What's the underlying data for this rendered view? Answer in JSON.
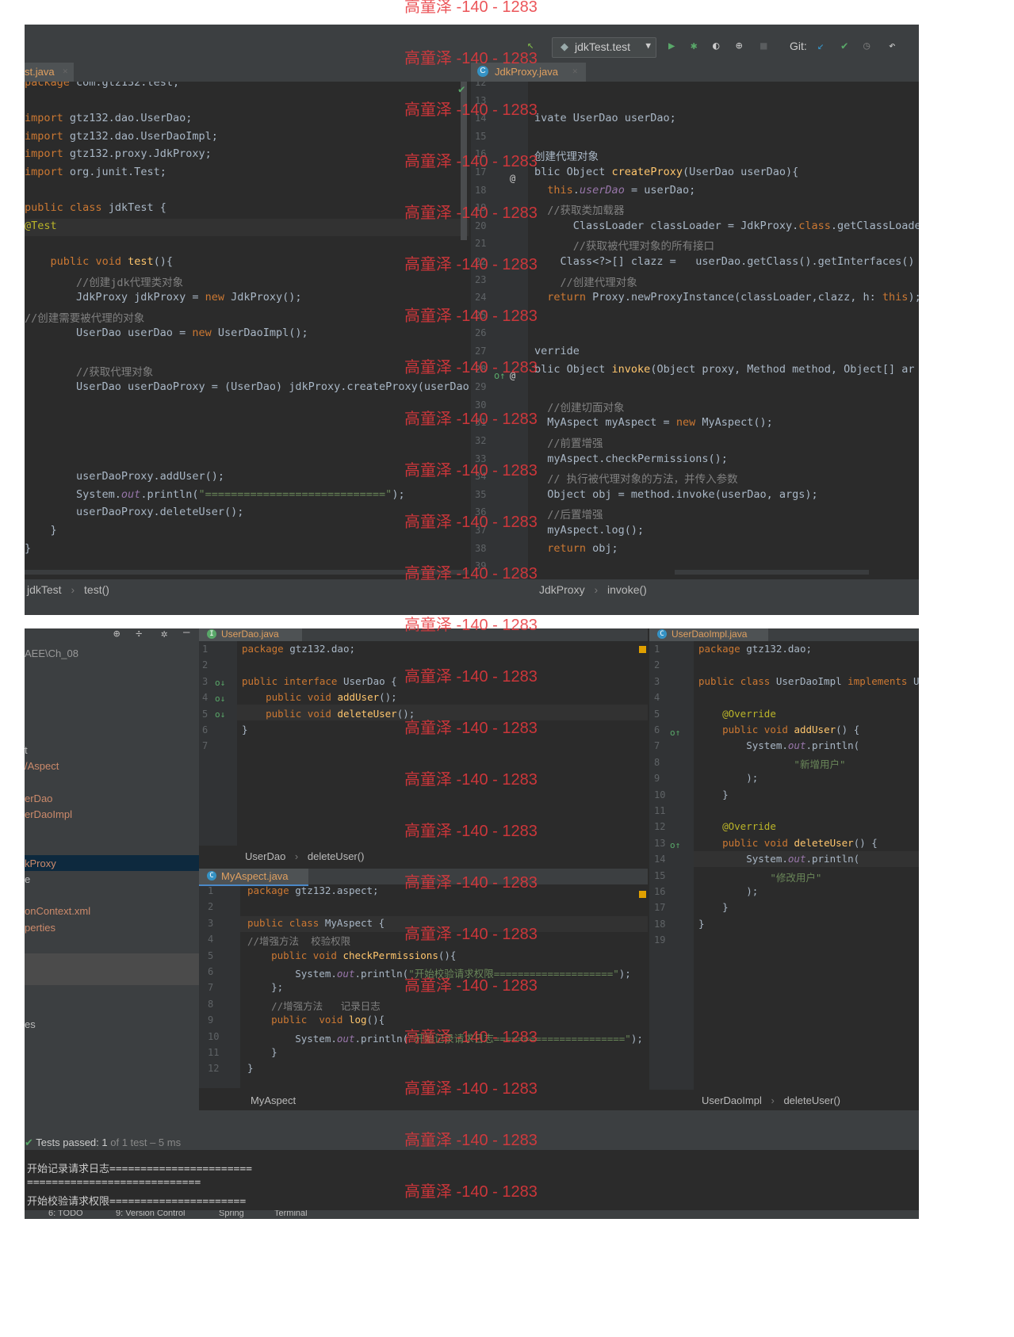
{
  "watermark": "高童泽 -140 - 1283",
  "top": {
    "toolbar": {
      "run_config": "jdkTest.test",
      "git_label": "Git:"
    },
    "left": {
      "tab": "st.java",
      "lines": [
        "package com.gtz132.test;",
        "",
        "import gtz132.dao.UserDao;",
        "import gtz132.dao.UserDaoImpl;",
        "import gtz132.proxy.JdkProxy;",
        "import org.junit.Test;",
        "",
        "public class jdkTest {",
        "@Test",
        "",
        "    public void test(){",
        "        //创建jdk代理类对象",
        "        JdkProxy jdkProxy = new JdkProxy();",
        "//创建需要被代理的对象",
        "        UserDao userDao = new UserDaoImpl();",
        "",
        "        //获取代理对象",
        "        UserDao userDaoProxy = (UserDao) jdkProxy.createProxy(userDao",
        "",
        "",
        "",
        "",
        "        userDaoProxy.addUser();",
        "        System.out.println(\"============================\");",
        "        userDaoProxy.deleteUser();",
        "    }",
        "}"
      ],
      "breadcrumb": [
        "jdkTest",
        "test()"
      ]
    },
    "right": {
      "tab": "JdkProxy.java",
      "line_numbers": [
        "12",
        "13",
        "14",
        "15",
        "16",
        "17",
        "18",
        "19",
        "20",
        "21",
        "22",
        "23",
        "24",
        "25",
        "26",
        "27",
        "28",
        "29",
        "30",
        "31",
        "32",
        "33",
        "34",
        "35",
        "36",
        "37",
        "38",
        "39"
      ],
      "lines": [
        "",
        "",
        "ivate UserDao userDao;",
        "",
        "创建代理对象",
        "blic Object createProxy(UserDao userDao){",
        "  this.userDao = userDao;",
        "  //获取类加载器",
        "      ClassLoader classLoader = JdkProxy.class.getClassLoade",
        "      //获取被代理对象的所有接口",
        "    Class<?>[] clazz =   userDao.getClass().getInterfaces()",
        "    //创建代理对象",
        "  return Proxy.newProxyInstance(classLoader,clazz, h: this);",
        "",
        "",
        "verride",
        "blic Object invoke(Object proxy, Method method, Object[] ar",
        "",
        "  //创建切面对象",
        "  MyAspect myAspect = new MyAspect();",
        "  //前置增强",
        "  myAspect.checkPermissions();",
        "  // 执行被代理对象的方法，并传入参数",
        "  Object obj = method.invoke(userDao, args);",
        "  //后置增强",
        "  myAspect.log();",
        "  return obj;",
        ""
      ],
      "breadcrumb": [
        "JdkProxy",
        "invoke()"
      ]
    }
  },
  "bottom": {
    "project_path": "AEE\\Ch_08",
    "tree": [
      "t",
      "/Aspect",
      "erDao",
      "erDaoImpl",
      "kProxy",
      "e",
      "onContext.xml",
      "perties",
      "es"
    ],
    "userdao": {
      "tab": "UserDao.java",
      "line_numbers": [
        "1",
        "2",
        "3",
        "4",
        "5",
        "6",
        "7"
      ],
      "lines": [
        "package gtz132.dao;",
        "",
        "public interface UserDao {",
        "    public void addUser();",
        "    public void deleteUser();",
        "}",
        ""
      ],
      "breadcrumb": [
        "UserDao",
        "deleteUser()"
      ]
    },
    "myaspect": {
      "tab": "MyAspect.java",
      "line_numbers": [
        "1",
        "2",
        "3",
        "4",
        "5",
        "6",
        "7",
        "8",
        "9",
        "10",
        "11",
        "12"
      ],
      "lines": [
        "package gtz132.aspect;",
        "",
        "public class MyAspect {",
        "//增强方法  校验权限",
        "    public void checkPermissions(){",
        "        System.out.println(\"开始校验请求权限====================\");",
        "    };",
        "    //增强方法   记录日志",
        "    public  void log(){",
        "        System.out.println(\"开始记录请求日志======================\");",
        "    }",
        "}"
      ],
      "breadcrumb": [
        "MyAspect"
      ]
    },
    "userdaoimpl": {
      "tab": "UserDaoImpl.java",
      "line_numbers": [
        "1",
        "2",
        "3",
        "4",
        "5",
        "6",
        "7",
        "8",
        "9",
        "10",
        "11",
        "12",
        "13",
        "14",
        "15",
        "16",
        "17",
        "18",
        "19"
      ],
      "lines": [
        "package gtz132.dao;",
        "",
        "public class UserDaoImpl implements Us",
        "",
        "    @Override",
        "    public void addUser() {",
        "        System.out.println(",
        "                \"新增用户\"",
        "        );",
        "    }",
        "",
        "    @Override",
        "    public void deleteUser() {",
        "        System.out.println(",
        "            \"修改用户\"",
        "        );",
        "    }",
        "}",
        ""
      ],
      "breadcrumb": [
        "UserDaoImpl",
        "deleteUser()"
      ]
    },
    "run": {
      "tests_passed": "Tests passed: 1",
      "tests_detail": "of 1 test – 5 ms",
      "output": [
        "开始记录请求日志=======================",
        "============================",
        "开始校验请求权限======================"
      ]
    },
    "statusbar": [
      "6: TODO",
      "9: Version Control",
      "Spring",
      "Terminal"
    ]
  }
}
